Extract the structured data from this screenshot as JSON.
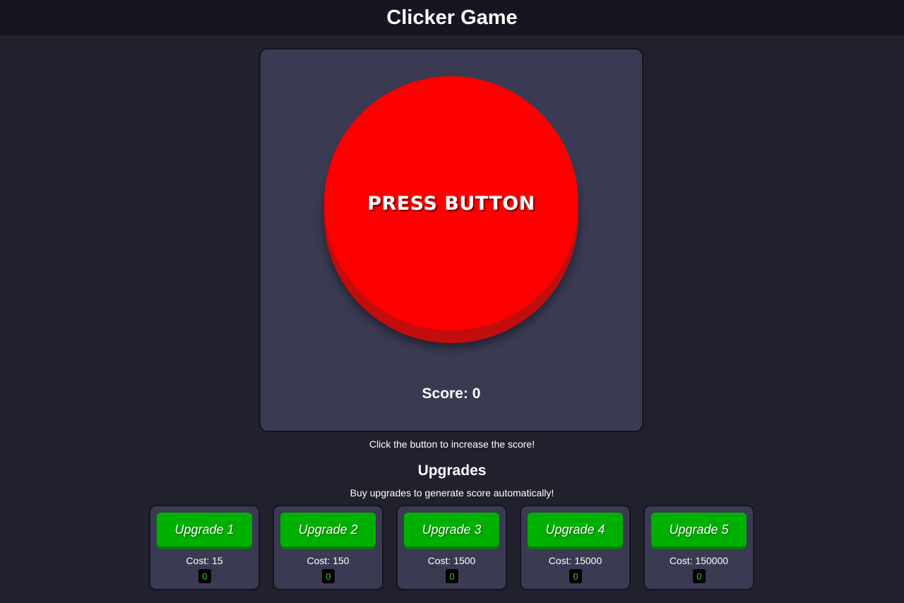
{
  "header": {
    "title": "Clicker Game"
  },
  "game": {
    "button_label": "PRESS BUTTON",
    "button_color": "#ff0000",
    "score_label": "Score:",
    "score_value": "0",
    "hint": "Click the button to increase the score!"
  },
  "upgrades": {
    "title": "Upgrades",
    "subtitle": "Buy upgrades to generate score automatically!",
    "cost_label": "Cost:",
    "button_color": "#00b000",
    "items": [
      {
        "label": "Upgrade 1",
        "cost": "15",
        "owned": "0"
      },
      {
        "label": "Upgrade 2",
        "cost": "150",
        "owned": "0"
      },
      {
        "label": "Upgrade 3",
        "cost": "1500",
        "owned": "0"
      },
      {
        "label": "Upgrade 4",
        "cost": "15000",
        "owned": "0"
      },
      {
        "label": "Upgrade 5",
        "cost": "150000",
        "owned": "0"
      }
    ]
  }
}
